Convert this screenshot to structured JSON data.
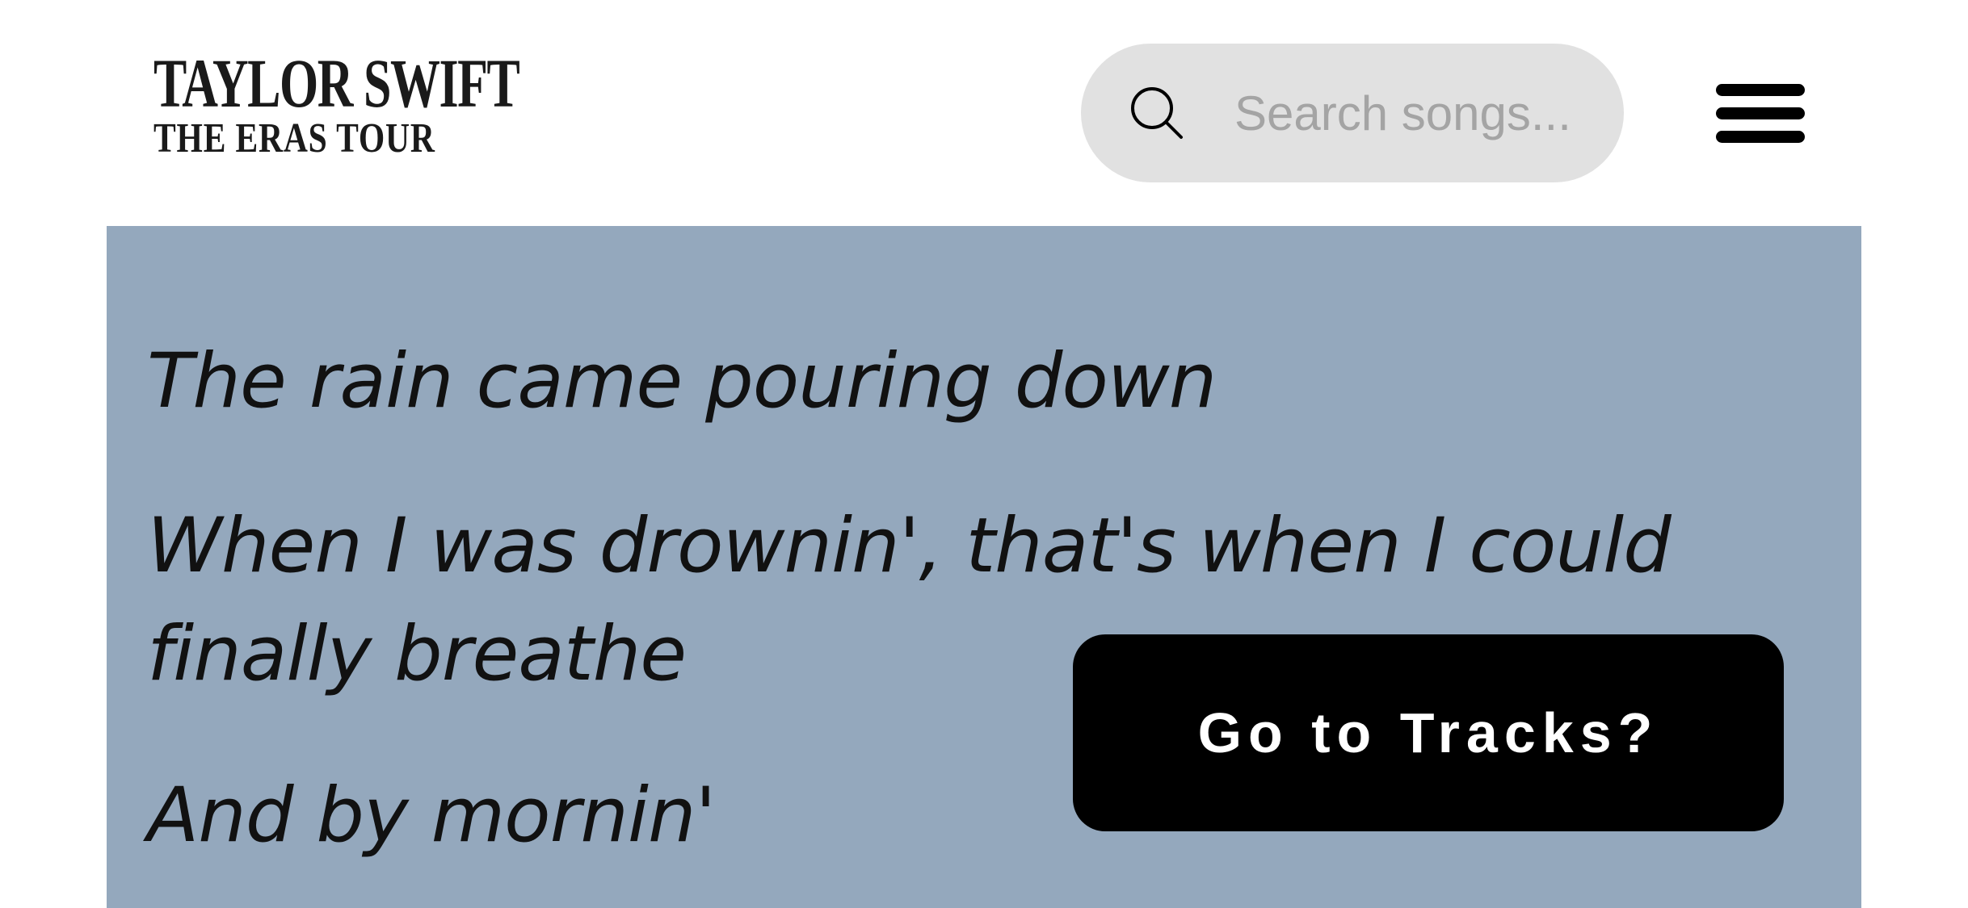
{
  "header": {
    "logo": {
      "line1": "TAYLOR SWIFT",
      "line2": "THE ERAS TOUR"
    },
    "search": {
      "icon": "search-icon",
      "placeholder": "Search songs...",
      "value": ""
    },
    "menu": {
      "icon": "hamburger-menu-icon"
    }
  },
  "lyrics": {
    "lines": [
      "The rain came pouring down",
      "When I was drownin', that's when I could finally breathe",
      "And by mornin'"
    ]
  },
  "cta": {
    "label": "Go to Tracks?"
  },
  "colors": {
    "header_background": "#ffffff",
    "lyrics_background": "#94a8bd",
    "search_background": "#e1e1e1",
    "search_placeholder": "#a4a4a4",
    "cta_background": "#000000",
    "cta_text": "#ffffff"
  }
}
